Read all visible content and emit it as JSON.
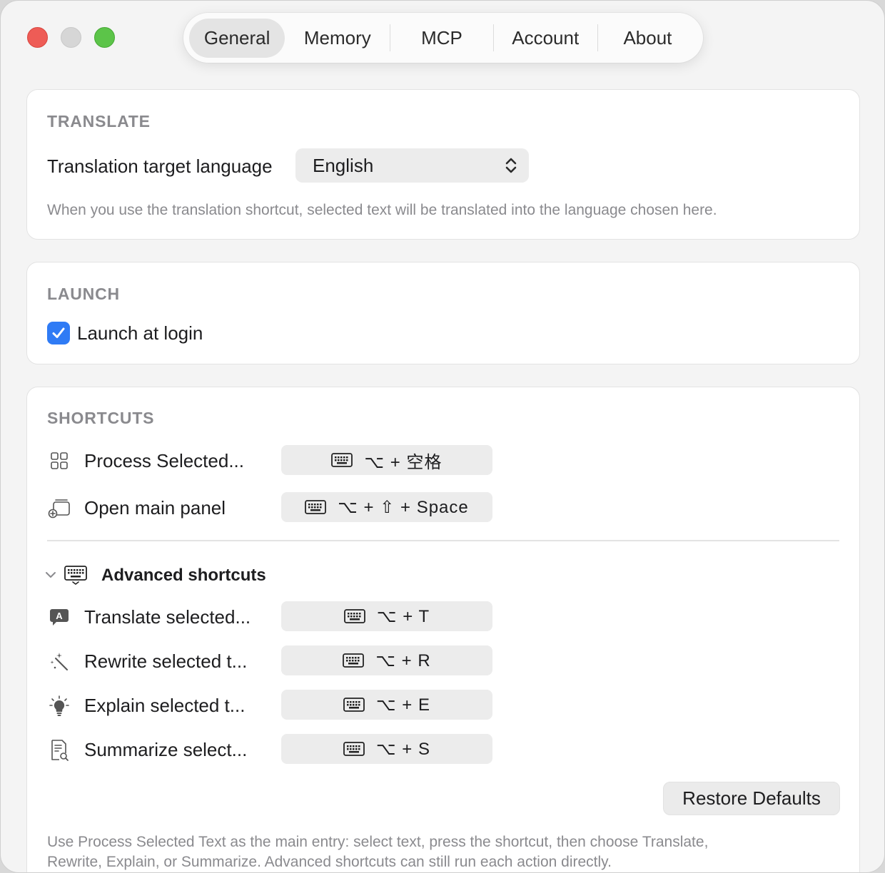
{
  "window": {
    "traffic_lights": [
      "close",
      "minimize",
      "zoom"
    ]
  },
  "tabs": [
    {
      "label": "General",
      "active": true
    },
    {
      "label": "Memory",
      "active": false
    },
    {
      "label": "MCP",
      "active": false
    },
    {
      "label": "Account",
      "active": false
    },
    {
      "label": "About",
      "active": false
    }
  ],
  "translate": {
    "section_title": "TRANSLATE",
    "target_label": "Translation target language",
    "target_value": "English",
    "help": "When you use the translation shortcut, selected text will be translated into the language chosen here."
  },
  "launch": {
    "section_title": "LAUNCH",
    "login_label": "Launch at login",
    "login_checked": true
  },
  "shortcuts": {
    "section_title": "SHORTCUTS",
    "items": [
      {
        "icon": "grid-icon",
        "label": "Process Selected...",
        "keys": "⌥ + 空格"
      },
      {
        "icon": "panel-add-icon",
        "label": "Open main panel",
        "keys": "⌥ + ⇧ + Space"
      }
    ],
    "advanced_label": "Advanced shortcuts",
    "advanced_expanded": true,
    "advanced": [
      {
        "icon": "translate-bubble-icon",
        "label": "Translate selected...",
        "keys": "⌥ + T"
      },
      {
        "icon": "magic-wand-icon",
        "label": "Rewrite selected t...",
        "keys": "⌥ + R"
      },
      {
        "icon": "lightbulb-icon",
        "label": "Explain selected t...",
        "keys": "⌥ + E"
      },
      {
        "icon": "document-search-icon",
        "label": "Summarize select...",
        "keys": "⌥ + S"
      }
    ],
    "restore_label": "Restore Defaults",
    "help_line1": "Use Process Selected Text as the main entry: select text, press the shortcut, then choose Translate,",
    "help_line2": "Rewrite, Explain, or Summarize. Advanced shortcuts can still run each action directly."
  },
  "colors": {
    "accent": "#2f7bf5",
    "close": "#ee5c56",
    "minimize": "#d6d6d6",
    "zoom": "#5cc449"
  }
}
